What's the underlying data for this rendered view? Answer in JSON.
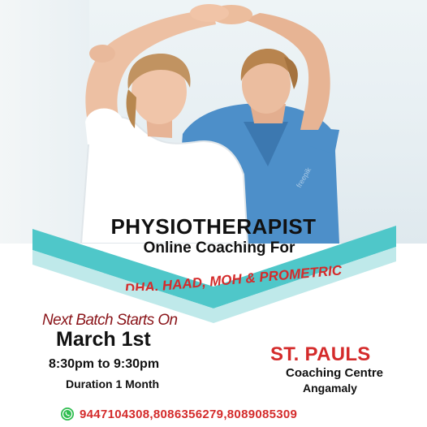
{
  "poster": {
    "title": "PHYSIOTHERAPIST",
    "subtitle": "Online Coaching For",
    "exams": "DHA, HAAD,  MOH & PROMETRIC",
    "next_batch_label": "Next Batch Starts On",
    "start_date": "March 1st",
    "timing": "8:30pm to 9:30pm",
    "duration": "Duration 1 Month",
    "org_name": "ST. PAULS",
    "org_sub": "Coaching Centre",
    "org_location": "Angamaly",
    "phones": "9447104308,8086356279,8089085309",
    "photo_icon": "therapist-patient-photo",
    "contact_icon": "whatsapp-icon"
  },
  "colors": {
    "teal": "#4fc7c9",
    "teal_light": "#bfe9ea",
    "red": "#d42b2b",
    "dark_red": "#8a1419",
    "scrub_blue": "#4d8fc9",
    "shirt_white": "#ffffff",
    "skin": "#e9b99b"
  }
}
